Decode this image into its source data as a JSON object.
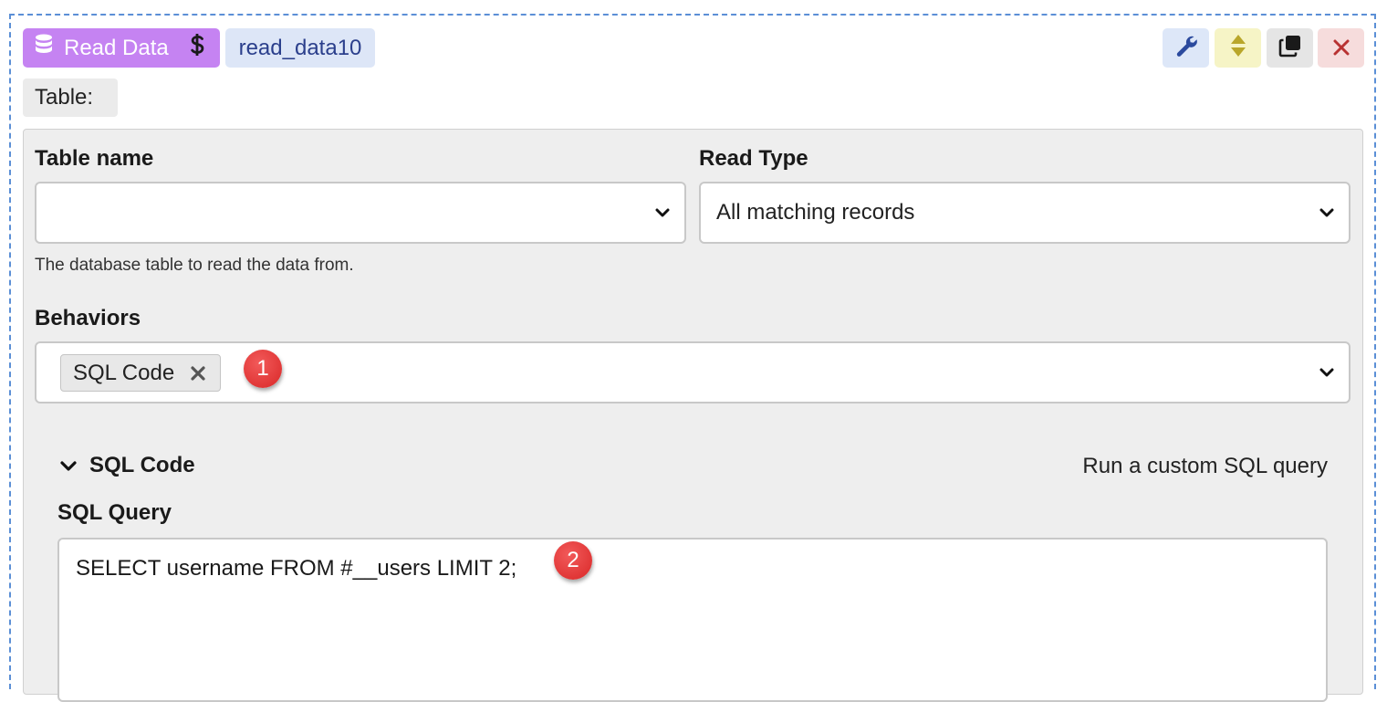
{
  "block": {
    "type_label": "Read Data",
    "type_icon": "database-icon",
    "type_secondary_icon": "dollar-icon",
    "name": "read_data10",
    "colors": {
      "type_badge": "#c583f2",
      "name_badge": "#dde6f7"
    }
  },
  "toolbar": {
    "buttons": [
      {
        "name": "settings",
        "icon": "wrench-icon"
      },
      {
        "name": "move",
        "icon": "sort-arrows-icon"
      },
      {
        "name": "duplicate",
        "icon": "copy-icon"
      },
      {
        "name": "delete",
        "icon": "close-icon"
      }
    ]
  },
  "header": {
    "table_label": "Table:"
  },
  "form": {
    "table_name": {
      "label": "Table name",
      "value": "",
      "help": "The database table to read the data from."
    },
    "read_type": {
      "label": "Read Type",
      "value": "All matching records"
    },
    "behaviors": {
      "label": "Behaviors",
      "selected": [
        "SQL Code"
      ]
    }
  },
  "sql_section": {
    "title": "SQL Code",
    "description": "Run a custom SQL query",
    "query_label": "SQL Query",
    "query_value": "SELECT username FROM #__users LIMIT 2;"
  },
  "markers": [
    "1",
    "2"
  ]
}
